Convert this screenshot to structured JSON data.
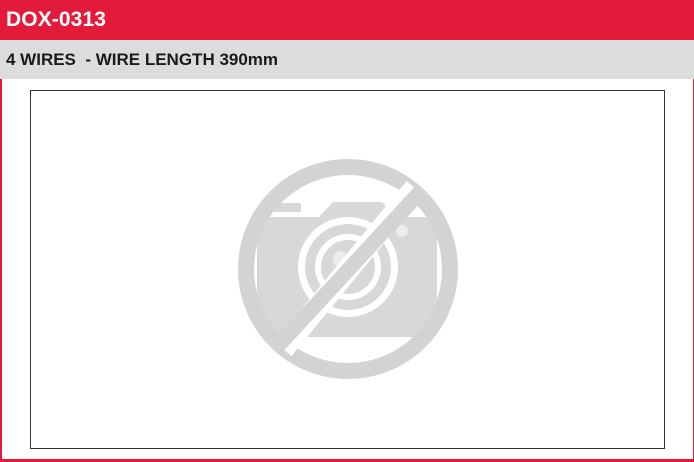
{
  "header": {
    "code": "DOX-0313",
    "description": "4 WIRES  - WIRE LENGTH 390mm"
  },
  "image": {
    "icon": "no-photo-icon"
  },
  "colors": {
    "accent": "#e31b3b",
    "subheader_bg": "#dcdcdc",
    "placeholder_grey": "#d3d3d3"
  }
}
